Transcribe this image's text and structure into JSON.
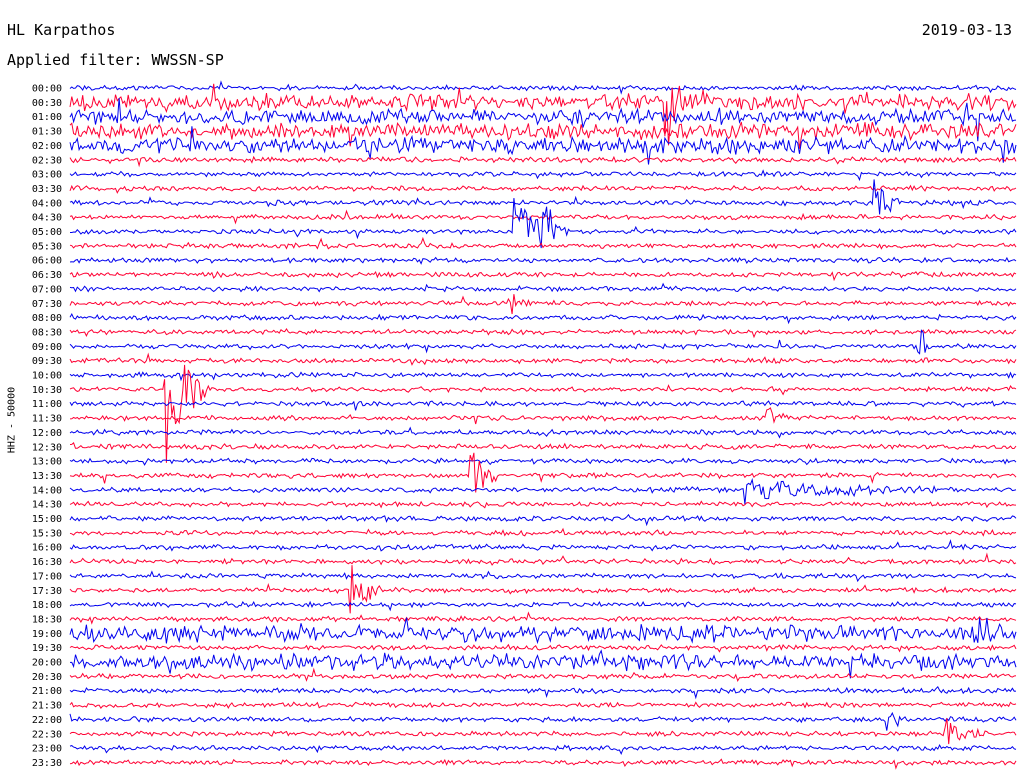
{
  "header": {
    "title": "HL Karpathos",
    "date": "2019-03-13",
    "filter": "Applied filter: WWSSN-SP"
  },
  "chart_data": {
    "type": "line",
    "title": "HL Karpathos",
    "date": "2019-03-13",
    "filter": "Applied filter: WWSSN-SP",
    "ylabel": "HHZ - 50000",
    "row_labels": [
      "00:00",
      "00:30",
      "01:00",
      "01:30",
      "02:00",
      "02:30",
      "03:00",
      "03:30",
      "04:00",
      "04:30",
      "05:00",
      "05:30",
      "06:00",
      "06:30",
      "07:00",
      "07:30",
      "08:00",
      "08:30",
      "09:00",
      "09:30",
      "10:00",
      "10:30",
      "11:00",
      "11:30",
      "12:00",
      "12:30",
      "13:00",
      "13:30",
      "14:00",
      "14:30",
      "15:00",
      "15:30",
      "16:00",
      "16:30",
      "17:00",
      "17:30",
      "18:00",
      "18:30",
      "19:00",
      "19:30",
      "20:00",
      "20:30",
      "21:00",
      "21:30",
      "22:00",
      "22:30",
      "23:00",
      "23:30"
    ],
    "series_colors": [
      "#0000ee",
      "#ff0033"
    ],
    "trace_minutes": 30,
    "events": [
      {
        "row": "00:30",
        "minute": 19.0,
        "amp": 3.5,
        "len_min": 0.6
      },
      {
        "row": "04:00",
        "minute": 25.6,
        "amp": 2.2,
        "len_min": 0.8
      },
      {
        "row": "05:00",
        "minute": 14.2,
        "amp": 2.8,
        "len_min": 1.2
      },
      {
        "row": "05:00",
        "minute": 15.0,
        "amp": 2.4,
        "len_min": 0.8
      },
      {
        "row": "07:30",
        "minute": 14.0,
        "amp": 1.0,
        "len_min": 0.8
      },
      {
        "row": "09:00",
        "minute": 27.0,
        "amp": 1.2,
        "len_min": 0.3
      },
      {
        "row": "10:30",
        "minute": 3.1,
        "amp": 6.0,
        "len_min": 1.3
      },
      {
        "row": "11:30",
        "minute": 22.2,
        "amp": 0.8,
        "len_min": 0.6
      },
      {
        "row": "13:30",
        "minute": 12.8,
        "amp": 2.6,
        "len_min": 0.8
      },
      {
        "row": "14:00",
        "minute": 21.5,
        "amp": 0.9,
        "len_min": 6.0
      },
      {
        "row": "17:30",
        "minute": 9.0,
        "amp": 2.6,
        "len_min": 0.9
      },
      {
        "row": "19:00",
        "minute": 28.8,
        "amp": 1.3,
        "len_min": 1.0
      },
      {
        "row": "22:00",
        "minute": 26.0,
        "amp": 1.0,
        "len_min": 0.6
      },
      {
        "row": "22:30",
        "minute": 27.8,
        "amp": 1.0,
        "len_min": 1.4
      }
    ],
    "noise_rows": [
      "00:30",
      "01:00",
      "01:30",
      "02:00",
      "19:00",
      "20:00"
    ]
  }
}
